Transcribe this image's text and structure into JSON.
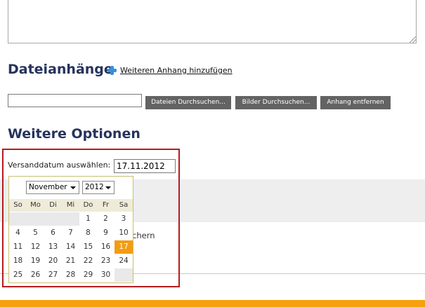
{
  "attachments": {
    "title": "Dateianhänge",
    "add_link": "Weiteren Anhang hinzufügen",
    "file_input_value": "",
    "buttons": {
      "browse_files": "Dateien Durchsuchen...",
      "browse_images": "Bilder Durchsuchen...",
      "remove": "Anhang entfernen"
    }
  },
  "options": {
    "title": "Weitere Optionen",
    "send_date_label": "Versanddatum auswählen:",
    "send_date_value": "17.11.2012",
    "partial_text": "chern"
  },
  "calendar": {
    "month": "November",
    "year": "2012",
    "weekdays": [
      "So",
      "Mo",
      "Di",
      "Mi",
      "Do",
      "Fr",
      "Sa"
    ],
    "weeks": [
      [
        "",
        "",
        "",
        "",
        "1",
        "2",
        "3"
      ],
      [
        "4",
        "5",
        "6",
        "7",
        "8",
        "9",
        "10"
      ],
      [
        "11",
        "12",
        "13",
        "14",
        "15",
        "16",
        "17"
      ],
      [
        "18",
        "19",
        "20",
        "21",
        "22",
        "23",
        "24"
      ],
      [
        "25",
        "26",
        "27",
        "28",
        "29",
        "30",
        ""
      ]
    ],
    "selected_day": "17"
  },
  "colors": {
    "title_text": "#26335c",
    "highlight_border": "#b51b20",
    "selected_day": "#f39c12",
    "button_bg": "#636363",
    "footer_bar": "#f5a00c",
    "add_icon": "#3b8fd9"
  },
  "icons": {
    "add": "plus-icon",
    "select": "chevron-down-icon"
  }
}
